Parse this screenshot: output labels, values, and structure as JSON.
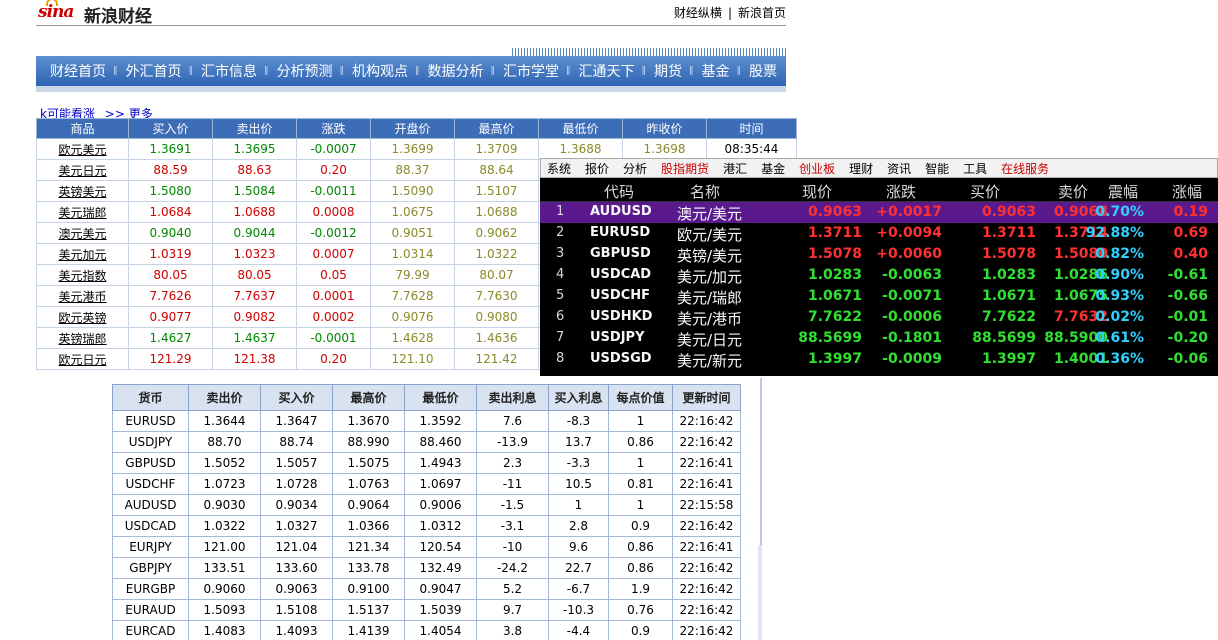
{
  "header": {
    "logo_text": "sina",
    "site_title": "新浪财经",
    "link_left": "财经纵横",
    "link_sep": "|",
    "link_right": "新浪首页"
  },
  "nav": {
    "separator": "‖",
    "items": [
      "财经首页",
      "外汇首页",
      "汇市信息",
      "分析预测",
      "机构观点",
      "数据分析",
      "汇市学堂",
      "汇通天下",
      "期货",
      "基金",
      "股票"
    ]
  },
  "quote_table": {
    "caption": "k可能看涨",
    "more_prefix": ">>",
    "more_link": "更多",
    "headers": [
      "商品",
      "买入价",
      "卖出价",
      "涨跌",
      "开盘价",
      "最高价",
      "最低价",
      "昨收价",
      "时间"
    ],
    "rows": [
      {
        "name": "欧元美元",
        "bid": "1.3691",
        "ask": "1.3695",
        "chg": "-0.0007",
        "open": "1.3699",
        "high": "1.3709",
        "low": "1.3688",
        "prev": "1.3698",
        "time": "08:35:44",
        "dir": "green"
      },
      {
        "name": "美元日元",
        "bid": "88.59",
        "ask": "88.63",
        "chg": "0.20",
        "open": "88.37",
        "high": "88.64",
        "low": "",
        "prev": "",
        "time": "",
        "dir": "red"
      },
      {
        "name": "英镑美元",
        "bid": "1.5080",
        "ask": "1.5084",
        "chg": "-0.0011",
        "open": "1.5090",
        "high": "1.5107",
        "low": "",
        "prev": "",
        "time": "",
        "dir": "green"
      },
      {
        "name": "美元瑞郎",
        "bid": "1.0684",
        "ask": "1.0688",
        "chg": "0.0008",
        "open": "1.0675",
        "high": "1.0688",
        "low": "",
        "prev": "",
        "time": "",
        "dir": "red"
      },
      {
        "name": "澳元美元",
        "bid": "0.9040",
        "ask": "0.9044",
        "chg": "-0.0012",
        "open": "0.9051",
        "high": "0.9062",
        "low": "",
        "prev": "",
        "time": "",
        "dir": "green"
      },
      {
        "name": "美元加元",
        "bid": "1.0319",
        "ask": "1.0323",
        "chg": "0.0007",
        "open": "1.0314",
        "high": "1.0322",
        "low": "",
        "prev": "",
        "time": "",
        "dir": "red"
      },
      {
        "name": "美元指数",
        "bid": "80.05",
        "ask": "80.05",
        "chg": "0.05",
        "open": "79.99",
        "high": "80.07",
        "low": "",
        "prev": "",
        "time": "",
        "dir": "red"
      },
      {
        "name": "美元港币",
        "bid": "7.7626",
        "ask": "7.7637",
        "chg": "0.0001",
        "open": "7.7628",
        "high": "7.7630",
        "low": "",
        "prev": "",
        "time": "",
        "dir": "red"
      },
      {
        "name": "欧元英镑",
        "bid": "0.9077",
        "ask": "0.9082",
        "chg": "0.0002",
        "open": "0.9076",
        "high": "0.9080",
        "low": "",
        "prev": "",
        "time": "",
        "dir": "red"
      },
      {
        "name": "英镑瑞郎",
        "bid": "1.4627",
        "ask": "1.4637",
        "chg": "-0.0001",
        "open": "1.4628",
        "high": "1.4636",
        "low": "",
        "prev": "",
        "time": "",
        "dir": "green"
      },
      {
        "name": "欧元日元",
        "bid": "121.29",
        "ask": "121.38",
        "chg": "0.20",
        "open": "121.10",
        "high": "121.42",
        "low": "",
        "prev": "",
        "time": "",
        "dir": "red"
      }
    ]
  },
  "terminal": {
    "menu": [
      {
        "label": "系统",
        "hot": false
      },
      {
        "label": "报价",
        "hot": false
      },
      {
        "label": "分析",
        "hot": false
      },
      {
        "label": "股指期货",
        "hot": true
      },
      {
        "label": "港汇",
        "hot": false
      },
      {
        "label": "基金",
        "hot": false
      },
      {
        "label": "创业板",
        "hot": true
      },
      {
        "label": "理财",
        "hot": false
      },
      {
        "label": "资讯",
        "hot": false
      },
      {
        "label": "智能",
        "hot": false
      },
      {
        "label": "工具",
        "hot": false
      },
      {
        "label": "在线服务",
        "hot": true
      }
    ],
    "headers": [
      "代码",
      "名称",
      "现价",
      "涨跌",
      "买价",
      "卖价",
      "震幅",
      "涨幅"
    ],
    "selected_row": 1,
    "rows": [
      {
        "idx": "1",
        "code": "AUDUSD",
        "name": "澳元/美元",
        "price": "0.9063",
        "chg": "+0.0017",
        "bid": "0.9063",
        "ask": "0.9068",
        "amp": "0.70%",
        "pct": "0.19",
        "dir": "up"
      },
      {
        "idx": "2",
        "code": "EURUSD",
        "name": "欧元/美元",
        "price": "1.3711",
        "chg": "+0.0094",
        "bid": "1.3711",
        "ask": "1.3714",
        "amp": "92.88%",
        "pct": "0.69",
        "dir": "up"
      },
      {
        "idx": "3",
        "code": "GBPUSD",
        "name": "英镑/美元",
        "price": "1.5078",
        "chg": "+0.0060",
        "bid": "1.5078",
        "ask": "1.5080",
        "amp": "0.82%",
        "pct": "0.40",
        "dir": "up"
      },
      {
        "idx": "4",
        "code": "USDCAD",
        "name": "美元/加元",
        "price": "1.0283",
        "chg": "-0.0063",
        "bid": "1.0283",
        "ask": "1.0286",
        "amp": "0.90%",
        "pct": "-0.61",
        "dir": "dn"
      },
      {
        "idx": "5",
        "code": "USDCHF",
        "name": "美元/瑞郎",
        "price": "1.0671",
        "chg": "-0.0071",
        "bid": "1.0671",
        "ask": "1.0675",
        "amp": "0.93%",
        "pct": "-0.66",
        "dir": "dn"
      },
      {
        "idx": "6",
        "code": "USDHKD",
        "name": "美元/港币",
        "price": "7.7622",
        "chg": "-0.0006",
        "bid": "7.7622",
        "ask": "7.7632",
        "amp": "0.02%",
        "pct": "-0.01",
        "dir": "dn"
      },
      {
        "idx": "7",
        "code": "USDJPY",
        "name": "美元/日元",
        "price": "88.5699",
        "chg": "-0.1801",
        "bid": "88.5699",
        "ask": "88.5900",
        "amp": "0.61%",
        "pct": "-0.20",
        "dir": "dn"
      },
      {
        "idx": "8",
        "code": "USDSGD",
        "name": "美元/新元",
        "price": "1.3997",
        "chg": "-0.0009",
        "bid": "1.3997",
        "ask": "1.4001",
        "amp": "0.36%",
        "pct": "-0.06",
        "dir": "dn"
      }
    ],
    "colors": {
      "up": "#ff3030",
      "down": "#30e030",
      "amplitude": "#30d0ff",
      "selected_bg": "#5a1a8e"
    }
  },
  "rate_table": {
    "headers": [
      "货币",
      "卖出价",
      "买入价",
      "最高价",
      "最低价",
      "卖出利息",
      "买入利息",
      "每点价值",
      "更新时间"
    ],
    "rows": [
      [
        "EURUSD",
        "1.3644",
        "1.3647",
        "1.3670",
        "1.3592",
        "7.6",
        "-8.3",
        "1",
        "22:16:42"
      ],
      [
        "USDJPY",
        "88.70",
        "88.74",
        "88.990",
        "88.460",
        "-13.9",
        "13.7",
        "0.86",
        "22:16:42"
      ],
      [
        "GBPUSD",
        "1.5052",
        "1.5057",
        "1.5075",
        "1.4943",
        "2.3",
        "-3.3",
        "1",
        "22:16:41"
      ],
      [
        "USDCHF",
        "1.0723",
        "1.0728",
        "1.0763",
        "1.0697",
        "-11",
        "10.5",
        "0.81",
        "22:16:41"
      ],
      [
        "AUDUSD",
        "0.9030",
        "0.9034",
        "0.9064",
        "0.9006",
        "-1.5",
        "1",
        "1",
        "22:15:58"
      ],
      [
        "USDCAD",
        "1.0322",
        "1.0327",
        "1.0366",
        "1.0312",
        "-3.1",
        "2.8",
        "0.9",
        "22:16:42"
      ],
      [
        "EURJPY",
        "121.00",
        "121.04",
        "121.34",
        "120.54",
        "-10",
        "9.6",
        "0.86",
        "22:16:41"
      ],
      [
        "GBPJPY",
        "133.51",
        "133.60",
        "133.78",
        "132.49",
        "-24.2",
        "22.7",
        "0.86",
        "22:16:42"
      ],
      [
        "EURGBP",
        "0.9060",
        "0.9063",
        "0.9100",
        "0.9047",
        "5.2",
        "-6.7",
        "1.9",
        "22:16:42"
      ],
      [
        "EURAUD",
        "1.5093",
        "1.5108",
        "1.5137",
        "1.5039",
        "9.7",
        "-10.3",
        "0.76",
        "22:16:42"
      ],
      [
        "EURCAD",
        "1.4083",
        "1.4093",
        "1.4139",
        "1.4054",
        "3.8",
        "-4.4",
        "0.9",
        "22:16:42"
      ]
    ]
  }
}
